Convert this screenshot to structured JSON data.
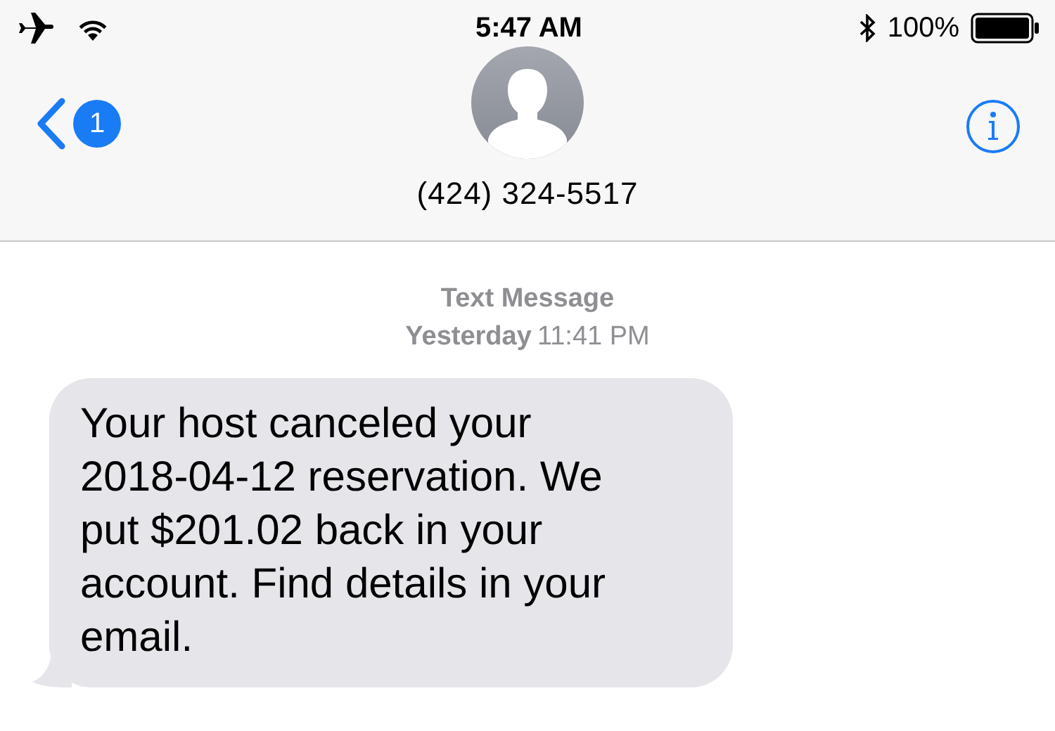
{
  "status_bar": {
    "time": "5:47 AM",
    "battery": "100%"
  },
  "header": {
    "back_badge": "1",
    "contact": "(424) 324-5517"
  },
  "thread": {
    "label": "Text Message",
    "day": "Yesterday",
    "time": "11:41 PM"
  },
  "messages": [
    {
      "kind": "received",
      "text": "Your host canceled your 2018-04-12 reservation. We put $201.02 back in your account. Find details in your email."
    }
  ]
}
